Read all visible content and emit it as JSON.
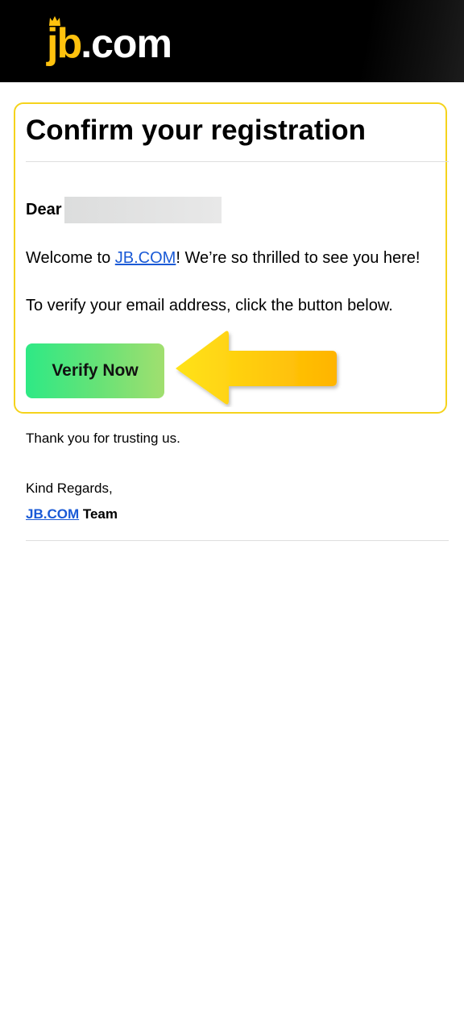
{
  "header": {
    "logo_part1": "jb",
    "logo_part2": ".com",
    "logo_color": "#ffc20e",
    "background": "#000000"
  },
  "email": {
    "title": "Confirm your registration",
    "greeting": "Dear",
    "welcome_prefix": "Welcome to ",
    "welcome_link": "JB.COM",
    "welcome_suffix": "! We’re so thrilled to see you here!",
    "verify_instruction": "To verify your email address, click the button below.",
    "verify_button_label": "Verify Now",
    "thanks": "Thank you for trusting us.",
    "regards": "Kind Regards,",
    "signature_link": "JB.COM",
    "signature_suffix": " Team"
  },
  "colors": {
    "card_border": "#f5d31c",
    "button_gradient_start": "#2ee985",
    "button_gradient_end": "#a1df6f",
    "arrow_gradient_start": "#ffe31a",
    "arrow_gradient_end": "#ffb400",
    "link": "#1a5ad6"
  },
  "icons": {
    "logo_crown": "crown-icon",
    "pointer_arrow": "arrow-left-icon"
  }
}
